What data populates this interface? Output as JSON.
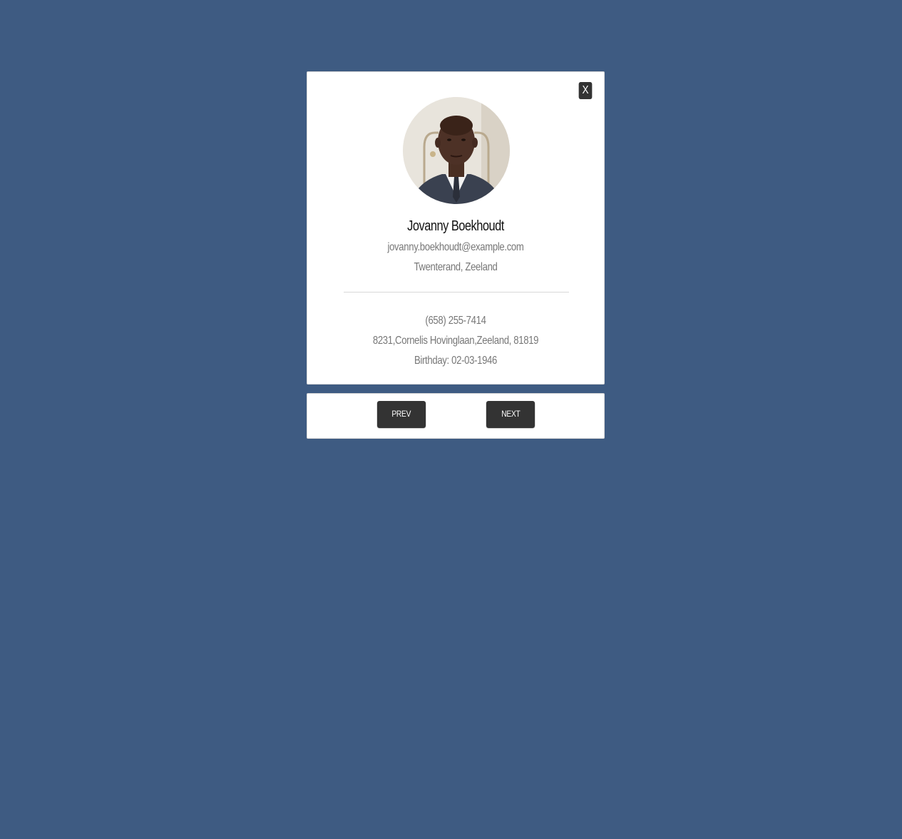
{
  "modal": {
    "close_label": "X",
    "avatar_icon": "profile-photo",
    "name": "Jovanny Boekhoudt",
    "email": "jovanny.boekhoudt@example.com",
    "location": "Twenterand, Zeeland",
    "phone": "(658) 255-7414",
    "address": "8231,Cornelis Hovinglaan,Zeeland, 81819",
    "birthday": "Birthday: 02-03-1946"
  },
  "navigation": {
    "prev_label": "PREV",
    "next_label": "NEXT"
  },
  "colors": {
    "background": "#3e5b82",
    "card": "#ffffff",
    "button": "#333333",
    "button_text": "#ffffff",
    "muted_text": "#777777"
  }
}
